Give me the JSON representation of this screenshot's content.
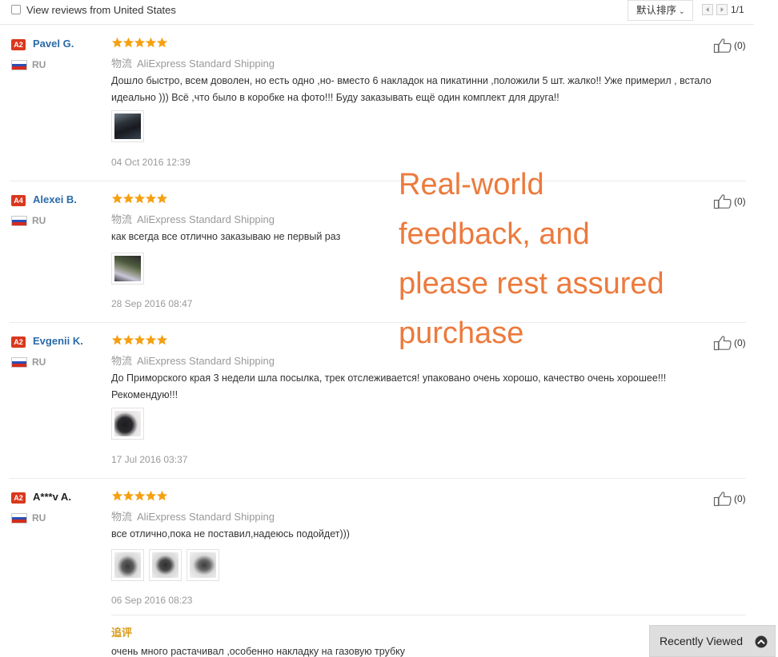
{
  "filter": {
    "label": "View reviews from United States",
    "checked": false
  },
  "sort": {
    "label": "默认排序",
    "chevron": "⌄"
  },
  "pagination": {
    "text": "1/1"
  },
  "shipping_prefix": "物流",
  "reviews": [
    {
      "badge": "A2",
      "user": "Pavel G.",
      "country": "RU",
      "rating": 5,
      "shipping": "AliExpress Standard Shipping",
      "text": "Дошло быстро, всем доволен, но есть одно ,но- вместо 6 накладок на пикатинни ,положили 5 шт. жалко!! Уже примерил , встало идеально ))) Всё ,что было в коробке на фото!!! Буду заказывать ещё один комплект для друга!!",
      "date": "04 Oct 2016 12:39",
      "likes": "(0)"
    },
    {
      "badge": "A4",
      "user": "Alexei B.",
      "country": "RU",
      "rating": 5,
      "shipping": "AliExpress Standard Shipping",
      "text": "как всегда все отлично заказываю не первый раз",
      "date": "28 Sep 2016 08:47",
      "likes": "(0)"
    },
    {
      "badge": "A2",
      "user": "Evgenii K.",
      "country": "RU",
      "rating": 5,
      "shipping": "AliExpress Standard Shipping",
      "text": "До Приморского края 3 недели шла посылка, трек отслеживается! упаковано очень хорошо, качество очень хорошее!!! Рекомендую!!!",
      "date": "17 Jul 2016 03:37",
      "likes": "(0)"
    },
    {
      "badge": "A2",
      "user": "A***v A.",
      "country": "RU",
      "rating": 5,
      "shipping": "AliExpress Standard Shipping",
      "text": "все отлично,пока не поставил,надеюсь подойдет)))",
      "date": "06 Sep 2016 08:23",
      "likes": "(0)",
      "append_label": "追评",
      "append_text": "очень много растачивал ,особенно накладку на газовую трубку"
    }
  ],
  "overlay": {
    "line1": "Real-world",
    "line2": "feedback, and",
    "line3": "please rest assured",
    "line4": "purchase"
  },
  "recently_viewed": {
    "label": "Recently Viewed",
    "icon": "chevron-up-circle-icon"
  },
  "colors": {
    "accent": "#d9381e",
    "username": "#2a6aa8",
    "star": "#f5a012",
    "overlay": "#ec7a3c",
    "append": "#d99a16"
  }
}
